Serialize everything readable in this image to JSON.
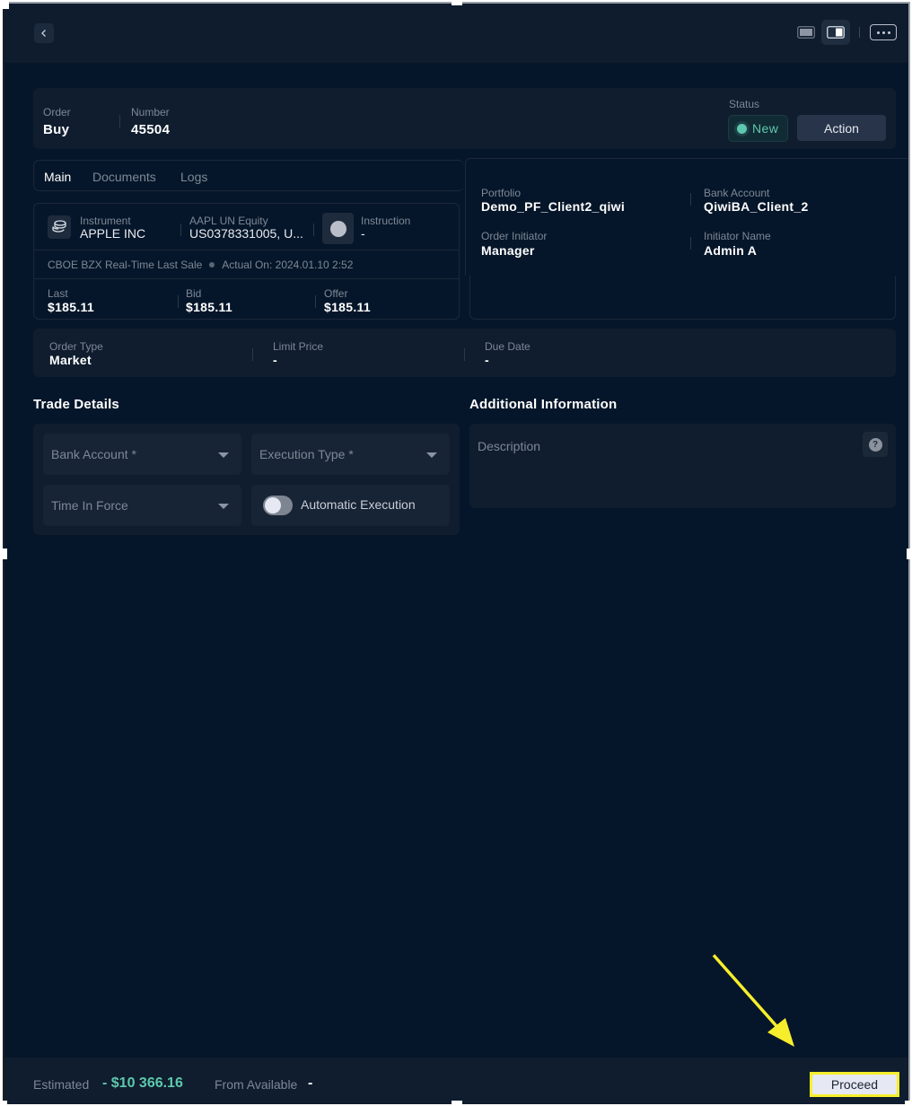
{
  "topbar": {
    "back_icon": "chevron-left-icon",
    "view_icons": [
      "single-panel-icon",
      "split-panel-icon"
    ],
    "more_icon": "ellipsis-icon"
  },
  "order_header": {
    "order_label": "Order",
    "order_value": "Buy",
    "number_label": "Number",
    "number_value": "45504",
    "status_label": "Status",
    "status_value": "New",
    "status_color": "#5ec8ae",
    "action_label": "Action"
  },
  "tabs": [
    {
      "label": "Main",
      "active": true
    },
    {
      "label": "Documents",
      "active": false
    },
    {
      "label": "Logs",
      "active": false
    }
  ],
  "instrument": {
    "icon": "coins-stack-icon",
    "label": "Instrument",
    "name": "APPLE INC",
    "ticker_label": "AAPL UN Equity",
    "ticker_value": "US0378331005, U...",
    "instruction_label": "Instruction",
    "instruction_value": "-",
    "feed_source": "CBOE BZX Real-Time Last Sale",
    "actual_on": "Actual On: 2024.01.10 2:52",
    "prices": [
      {
        "label": "Last",
        "value": "$185.11"
      },
      {
        "label": "Bid",
        "value": "$185.11"
      },
      {
        "label": "Offer",
        "value": "$185.11"
      }
    ]
  },
  "details": {
    "portfolio_label": "Portfolio",
    "portfolio_value": "Demo_PF_Client2_qiwi",
    "bank_account_label": "Bank Account",
    "bank_account_value": "QiwiBA_Client_2",
    "order_initiator_label": "Order Initiator",
    "order_initiator_value": "Manager",
    "initiator_name_label": "Initiator Name",
    "initiator_name_value": "Admin A"
  },
  "order_params": {
    "order_type_label": "Order Type",
    "order_type_value": "Market",
    "limit_price_label": "Limit Price",
    "limit_price_value": "-",
    "due_date_label": "Due Date",
    "due_date_value": "-"
  },
  "trade_details": {
    "title": "Trade Details",
    "bank_account_placeholder": "Bank Account *",
    "execution_type_placeholder": "Execution Type *",
    "time_in_force_placeholder": "Time In Force",
    "automatic_execution_label": "Automatic Execution",
    "automatic_execution_on": false
  },
  "additional_info": {
    "title": "Additional Information",
    "description_placeholder": "Description",
    "help_icon": "question-circle-icon",
    "help_glyph": "?"
  },
  "footer": {
    "estimated_label": "Estimated",
    "estimated_value": "- $10 366.16",
    "from_available_label": "From Available",
    "from_available_value": "-",
    "proceed_label": "Proceed",
    "highlight_color": "#f6ee2c"
  }
}
